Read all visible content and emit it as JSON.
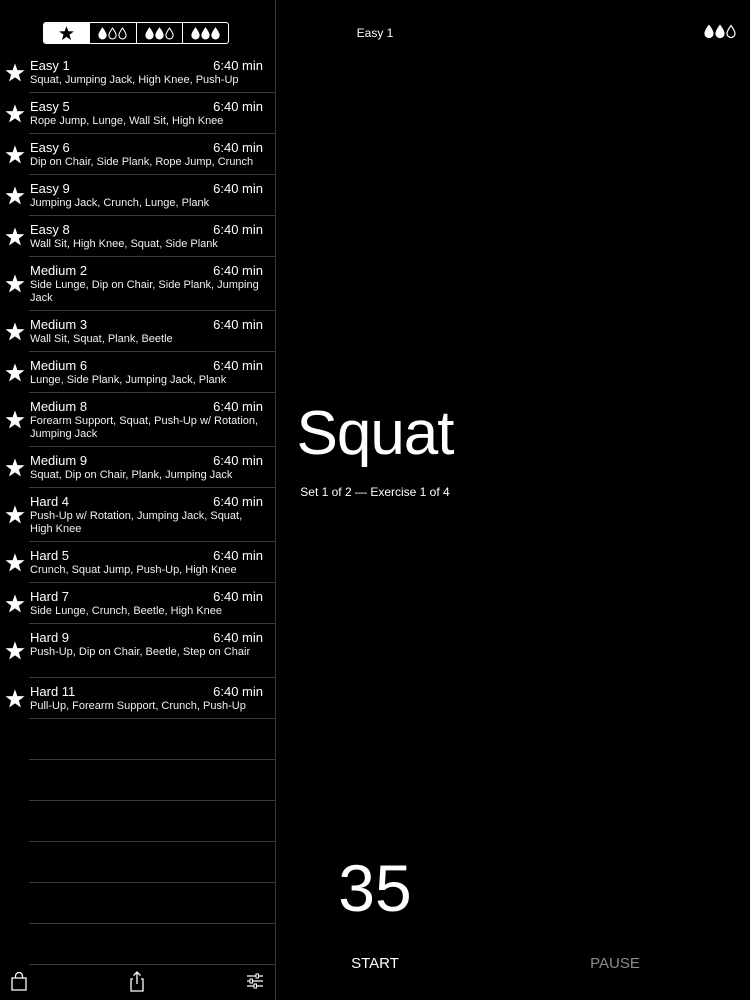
{
  "filter_tabs": [
    {
      "label": "favorites",
      "icon": "star-icon",
      "drops": 0,
      "active": true
    },
    {
      "label": "easy",
      "icon": "one-drop-icon",
      "drops": 1,
      "active": false
    },
    {
      "label": "medium",
      "icon": "two-drops-icon",
      "drops": 2,
      "active": false
    },
    {
      "label": "hard",
      "icon": "three-drops-icon",
      "drops": 3,
      "active": false
    }
  ],
  "workouts": [
    {
      "title": "Easy 1",
      "duration": "6:40 min",
      "exercises": "Squat, Jumping Jack, High Knee, Push-Up"
    },
    {
      "title": "Easy 5",
      "duration": "6:40 min",
      "exercises": "Rope Jump, Lunge, Wall Sit, High Knee"
    },
    {
      "title": "Easy 6",
      "duration": "6:40 min",
      "exercises": "Dip on Chair, Side Plank, Rope Jump, Crunch"
    },
    {
      "title": "Easy 9",
      "duration": "6:40 min",
      "exercises": "Jumping Jack, Crunch, Lunge, Plank"
    },
    {
      "title": "Easy 8",
      "duration": "6:40 min",
      "exercises": "Wall Sit, High Knee, Squat, Side Plank"
    },
    {
      "title": "Medium 2",
      "duration": "6:40 min",
      "exercises": "Side Lunge, Dip on Chair, Side Plank, Jumping Jack"
    },
    {
      "title": "Medium 3",
      "duration": "6:40 min",
      "exercises": "Wall Sit, Squat, Plank, Beetle"
    },
    {
      "title": "Medium 6",
      "duration": "6:40 min",
      "exercises": "Lunge, Side Plank, Jumping Jack, Plank"
    },
    {
      "title": "Medium 8",
      "duration": "6:40 min",
      "exercises": "Forearm Support, Squat, Push-Up w/ Rotation, Jumping Jack"
    },
    {
      "title": "Medium 9",
      "duration": "6:40 min",
      "exercises": "Squat, Dip on Chair, Plank, Jumping Jack"
    },
    {
      "title": "Hard 4",
      "duration": "6:40 min",
      "exercises": "Push-Up w/ Rotation, Jumping Jack, Squat, High Knee"
    },
    {
      "title": "Hard 5",
      "duration": "6:40 min",
      "exercises": "Crunch, Squat Jump, Push-Up, High Knee"
    },
    {
      "title": "Hard 7",
      "duration": "6:40 min",
      "exercises": "Side Lunge, Crunch, Beetle, High Knee"
    },
    {
      "title": "Hard 9",
      "duration": "6:40 min",
      "exercises": "Push-Up, Dip on Chair, Beetle, Step on Chair"
    },
    {
      "title": "Hard 11",
      "duration": "6:40 min",
      "exercises": "Pull-Up, Forearm Support, Crunch, Push-Up"
    }
  ],
  "toolbar": {
    "icons": [
      "shopping-bag-icon",
      "share-icon",
      "settings-sliders-icon"
    ]
  },
  "detail": {
    "title": "Easy 1",
    "difficulty_icon": "two-drops-icon",
    "difficulty_drops": 2,
    "exercise": "Squat",
    "progress": "Set 1 of 2 — Exercise 1 of 4",
    "countdown": "35",
    "start_label": "START",
    "pause_label": "PAUSE"
  },
  "colors": {
    "background": "#000000",
    "text": "#ffffff",
    "separator": "#3c3c3c",
    "disabled": "#8c8c8c"
  }
}
